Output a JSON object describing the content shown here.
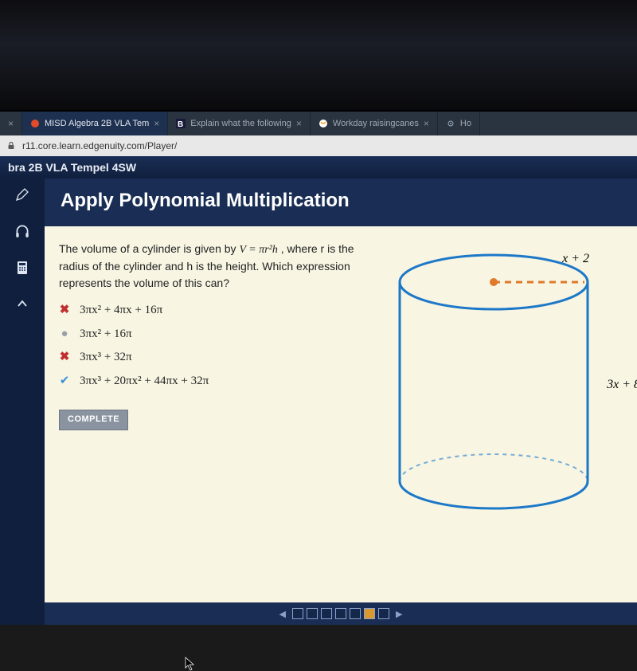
{
  "tabs": [
    {
      "label": "",
      "close": "×"
    },
    {
      "label": "MISD Algebra 2B VLA Tem",
      "close": "×"
    },
    {
      "label": "Explain what the following",
      "close": "×"
    },
    {
      "label": "Workday raisingcanes",
      "close": "×"
    },
    {
      "label": "Ho",
      "close": ""
    }
  ],
  "url": "r11.core.learn.edgenuity.com/Player/",
  "course_header": "bra 2B VLA Tempel 4SW",
  "slide_title": "Apply Polynomial Multiplication",
  "question": {
    "stem_pre": "The volume of a cylinder is given by ",
    "stem_formula": "V = πr²h",
    "stem_post": ", where r is the radius of the cylinder and h is the height. Which expression represents the volume of this can?"
  },
  "options": [
    {
      "mark": "x",
      "text": "3πx² + 4πx + 16π"
    },
    {
      "mark": "dot",
      "text": "3πx² + 16π"
    },
    {
      "mark": "x",
      "text": "3πx³ + 32π"
    },
    {
      "mark": "chk",
      "text": "3πx³ + 20πx² + 44πx + 32π"
    }
  ],
  "complete_label": "COMPLETE",
  "figure": {
    "radius_label": "x + 2",
    "height_label": "3x + 8"
  },
  "marks": {
    "x": "✖",
    "dot": "●",
    "chk": "✔"
  }
}
